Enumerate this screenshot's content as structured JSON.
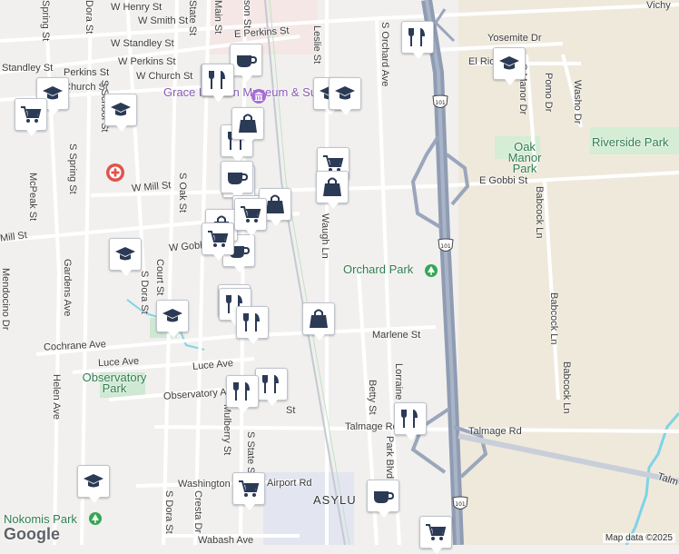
{
  "map": {
    "attribution": "Map data ©2025",
    "logo_text": "Google",
    "highway_shield": "101",
    "colors": {
      "background": "#f1f0ee",
      "road": "#ffffff",
      "highway": "#8f9cb3",
      "park": "#cfe8d3",
      "water": "#7fd3e6",
      "pin_icon": "#2b3a55",
      "hospital": "#e0544b"
    }
  },
  "streets": {
    "w_henry": "W Henry St",
    "w_smith": "W Smith St",
    "w_standley": "W Standley St",
    "e_perkins": "E Perkins St",
    "w_perkins": "W Perkins St",
    "w_church": "W Church St",
    "standley": "Standley St",
    "perkins": "Perkins St",
    "church": "Church St",
    "w_mill": "W Mill St",
    "mill": "Mill St",
    "w_gobbi": "W Gobbi St",
    "e_gobbi": "E Gobbi St",
    "cochrane": "Cochrane Ave",
    "luce": "Luce Ave",
    "observatory": "Observatory Ave",
    "talmage": "Talmage Rd",
    "talmage2": "Talmage Rd",
    "washington": "Washington Ave",
    "airport": "Airport Rd",
    "wabash": "Wabash Ave",
    "marlene": "Marlene St",
    "yosemite": "Yosemite Dr",
    "el_rio": "El Rio St",
    "vichy": "Vichy",
    "talm": "Talm",
    "mendocino": "Mendocino Dr",
    "s_spring": "S Spring St",
    "mcpeak": "McPeak St",
    "gardens": "Gardens Ave",
    "helen": "Helen Ave",
    "s_dora": "S Dora St",
    "s_dora2": "S Dora St",
    "s_dora3": "S Dora St",
    "court": "Court St",
    "s_oak": "S Oak St",
    "s_state": "S State St",
    "cresta": "Cresta Dr",
    "mulberry": "Mulberry St",
    "waugh": "Waugh Ln",
    "leslie": "Leslie St",
    "s_orchard": "S Orchard Ave",
    "betty": "Betty St",
    "lorraine": "Lorraine St",
    "park_blvd": "Park Blvd",
    "babcock1": "Babcock Ln",
    "babcock2": "Babcock Ln",
    "babcock3": "Babcock Ln",
    "s_manor": "S Manor Dr",
    "pomo": "Pomo Dr",
    "washo": "Washo Dr",
    "spring_top": "Spring St",
    "dora_top": "Dora St",
    "main_top": "Main St",
    "state_top": "State St",
    "s_school": "S School St",
    "son": "son St",
    "st_fragment": "St"
  },
  "places": {
    "grace_hudson": "Grace Hudson Museum & Sun House",
    "oak_manor_park": "Oak Manor Park",
    "riverside_park": "Riverside Park",
    "orchard_park": "Orchard Park",
    "observatory_park": "Observatory Park",
    "nokomis_park": "Nokomis Park",
    "asylum": "ASYLU"
  },
  "pins": [
    {
      "type": "school"
    },
    {
      "type": "cart"
    },
    {
      "type": "school"
    },
    {
      "type": "school"
    },
    {
      "type": "cart"
    },
    {
      "type": "coffee"
    },
    {
      "type": "restaurant"
    },
    {
      "type": "restaurant"
    },
    {
      "type": "school"
    },
    {
      "type": "school"
    },
    {
      "type": "bag"
    },
    {
      "type": "restaurant"
    },
    {
      "type": "coffee"
    },
    {
      "type": "coffee"
    },
    {
      "type": "cart"
    },
    {
      "type": "bag"
    },
    {
      "type": "bag"
    },
    {
      "type": "cart"
    },
    {
      "type": "cart"
    },
    {
      "type": "restaurant"
    },
    {
      "type": "coffee"
    },
    {
      "type": "school"
    },
    {
      "type": "bag"
    },
    {
      "type": "restaurant"
    },
    {
      "type": "restaurant"
    },
    {
      "type": "bag"
    },
    {
      "type": "restaurant"
    },
    {
      "type": "restaurant"
    },
    {
      "type": "restaurant"
    },
    {
      "type": "restaurant"
    },
    {
      "type": "school"
    },
    {
      "type": "cart"
    },
    {
      "type": "coffee"
    },
    {
      "type": "cart"
    },
    {
      "type": "school"
    }
  ]
}
